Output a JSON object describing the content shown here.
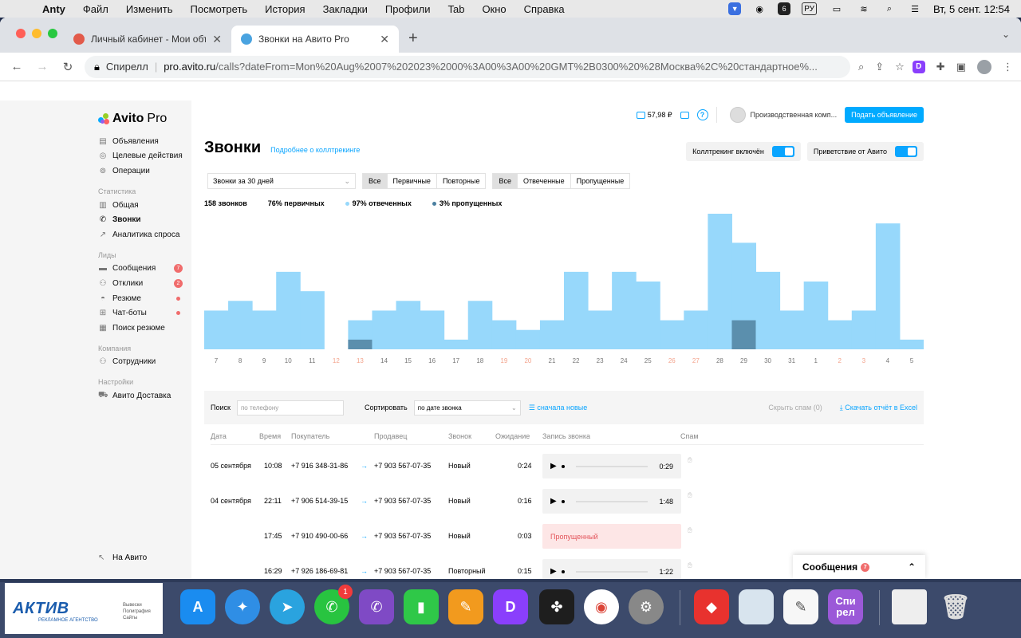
{
  "menubar": {
    "app": "Anty",
    "items": [
      "Файл",
      "Изменить",
      "Посмотреть",
      "История",
      "Закладки",
      "Профили",
      "Tab",
      "Окно",
      "Справка"
    ],
    "lang": "РУ",
    "datetime": "Вт, 5 сент.  12:54",
    "tray_badge": "6"
  },
  "browser": {
    "tabs": [
      {
        "title": "Личный кабинет - Мои объявления",
        "favicon_color": "#e25a4a"
      },
      {
        "title": "Звонки на Авито Pro",
        "favicon_color": "#4aa3e0"
      }
    ],
    "address": {
      "site": "Спирелл",
      "host": "pro.avito.ru",
      "path": "/calls?dateFrom=Mon%20Aug%2007%202023%2000%3A00%3A00%20GMT%2B0300%20%28Москва%2C%20стандартное%..."
    },
    "ext_letter": "D"
  },
  "sidebar": {
    "logo_main": "Avito",
    "logo_pro": "Pro",
    "top_items": [
      {
        "label": "Объявления",
        "icon": "listing-icon",
        "glyph": "▤"
      },
      {
        "label": "Целевые действия",
        "icon": "target-icon",
        "glyph": "◎"
      },
      {
        "label": "Операции",
        "icon": "operations-icon",
        "glyph": "⊚"
      }
    ],
    "stats_section": "Статистика",
    "stats_items": [
      {
        "label": "Общая",
        "icon": "bar-chart-icon",
        "glyph": "▥"
      },
      {
        "label": "Звонки",
        "icon": "phone-icon",
        "glyph": "✆",
        "active": true
      },
      {
        "label": "Аналитика спроса",
        "icon": "trend-icon",
        "glyph": "↗"
      }
    ],
    "leads_section": "Лиды",
    "leads_items": [
      {
        "label": "Сообщения",
        "icon": "chat-icon",
        "glyph": "▬",
        "badge": "7"
      },
      {
        "label": "Отклики",
        "icon": "people-icon",
        "glyph": "⚇",
        "badge": "2"
      },
      {
        "label": "Резюме",
        "icon": "resume-icon",
        "glyph": "◓",
        "dot": true
      },
      {
        "label": "Чат-боты",
        "icon": "bot-icon",
        "glyph": "⊞",
        "dot": true
      },
      {
        "label": "Поиск резюме",
        "icon": "search-resume-icon",
        "glyph": "▦"
      }
    ],
    "company_section": "Компания",
    "company_items": [
      {
        "label": "Сотрудники",
        "icon": "staff-icon",
        "glyph": "⚇"
      }
    ],
    "settings_section": "Настройки",
    "settings_items": [
      {
        "label": "Авито Доставка",
        "icon": "truck-icon",
        "glyph": "⛟"
      }
    ],
    "footer": "На Авито"
  },
  "topbar": {
    "balance": "57,98 ₽",
    "company": "Производственная комп...",
    "post_button": "Подать объявление"
  },
  "page": {
    "title": "Звонки",
    "title_link": "Подробнее о коллтрекинге",
    "toggle_calltracking": "Коллтрекинг включён",
    "toggle_greeting": "Приветствие от Авито",
    "period": "Звонки за 30 дней",
    "seg1": [
      "Все",
      "Первичные",
      "Повторные"
    ],
    "seg2": [
      "Все",
      "Отвеченные",
      "Пропущенные"
    ],
    "stats": {
      "total": "158 звонков",
      "primary": "76% первичных",
      "answered": "97% отвеченных",
      "missed": "3% пропущенных"
    }
  },
  "chart_data": {
    "type": "bar",
    "categories": [
      "7",
      "8",
      "9",
      "10",
      "11",
      "12",
      "13",
      "14",
      "15",
      "16",
      "17",
      "18",
      "19",
      "20",
      "21",
      "22",
      "23",
      "24",
      "25",
      "26",
      "27",
      "28",
      "29",
      "30",
      "31",
      "1",
      "2",
      "3",
      "4",
      "5"
    ],
    "weekend": [
      "12",
      "13",
      "19",
      "20",
      "26",
      "27",
      "2",
      "3"
    ],
    "series": [
      {
        "name": "answered",
        "color": "#97d8fb",
        "values": [
          4,
          5,
          4,
          8,
          6,
          0,
          3,
          4,
          5,
          4,
          1,
          5,
          3,
          2,
          3,
          8,
          4,
          8,
          7,
          3,
          4,
          14,
          11,
          8,
          4,
          7,
          3,
          4,
          13,
          1
        ]
      },
      {
        "name": "missed",
        "color": "#5b8fad",
        "values": [
          0,
          0,
          0,
          0,
          0,
          0,
          1,
          0,
          0,
          0,
          0,
          0,
          0,
          0,
          0,
          0,
          0,
          0,
          0,
          0,
          0,
          0,
          3,
          0,
          0,
          0,
          0,
          0,
          0,
          0
        ]
      }
    ],
    "ylim": [
      0,
      14
    ]
  },
  "table_tools": {
    "search_label": "Поиск",
    "search_placeholder": "по телефону",
    "sort_label": "Сортировать",
    "sort_value": "по дате звонка",
    "newest": "сначала новые",
    "hide_spam": "Скрыть спам (0)",
    "excel": "Скачать отчёт в Excel"
  },
  "table": {
    "headers": [
      "Дата",
      "Время",
      "Покупатель",
      "Продавец",
      "Звонок",
      "Ожидание",
      "Запись звонка",
      "Спам"
    ],
    "rows": [
      {
        "date": "05 сентября",
        "time": "10:08",
        "buyer": "+7 916 348-31-86",
        "seller": "+7 903 567-07-35",
        "type": "Новый",
        "wait": "0:24",
        "record": "0:29",
        "missed": false
      },
      {
        "date": "04 сентября",
        "time": "22:11",
        "buyer": "+7 906 514-39-15",
        "seller": "+7 903 567-07-35",
        "type": "Новый",
        "wait": "0:16",
        "record": "1:48",
        "missed": false
      },
      {
        "date": "",
        "time": "17:45",
        "buyer": "+7 910 490-00-66",
        "seller": "+7 903 567-07-35",
        "type": "Новый",
        "wait": "0:03",
        "record": "Пропущенный",
        "missed": true
      },
      {
        "date": "",
        "time": "16:29",
        "buyer": "+7 926 186-69-81",
        "seller": "+7 903 567-07-35",
        "type": "Повторный",
        "wait": "0:15",
        "record": "1:22",
        "missed": false
      }
    ]
  },
  "messages_widget": {
    "label": "Сообщения",
    "count": "7"
  },
  "dock": {
    "whatsapp_badge": "1",
    "spirell_label_1": "Спи",
    "spirell_label_2": "рел"
  },
  "watermark": {
    "brand": "АКТИВ",
    "tagline": "РЕКЛАМНОЕ АГЕНТСТВО",
    "services": [
      "Вывески",
      "Полиграфия",
      "Сайты"
    ]
  }
}
